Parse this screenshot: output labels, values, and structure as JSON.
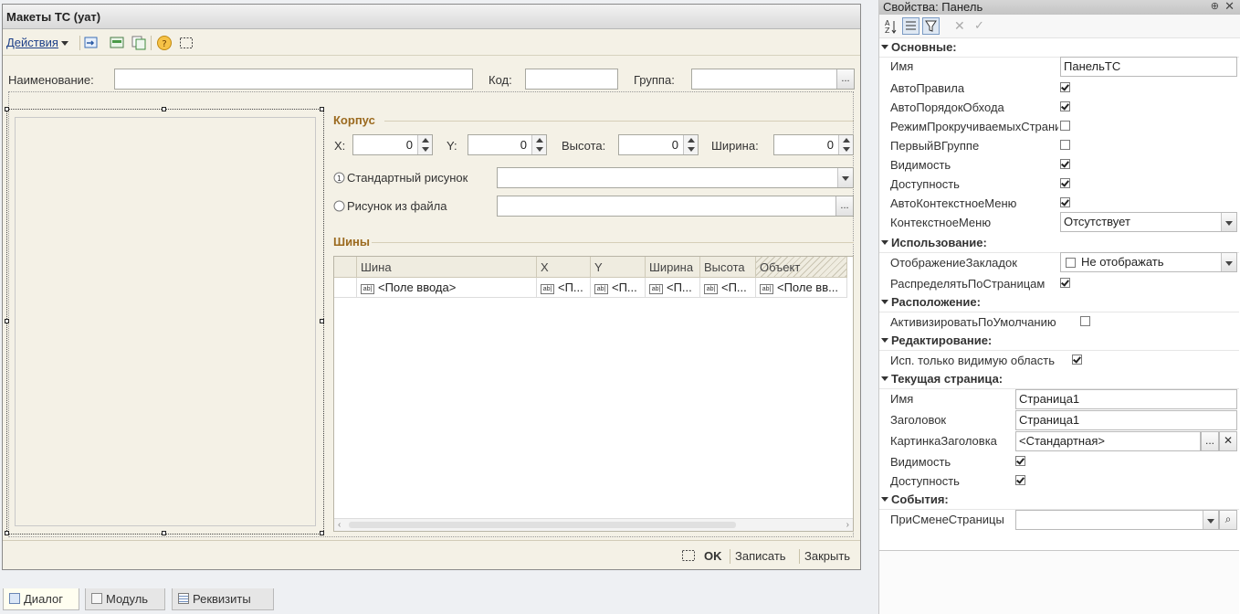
{
  "window": {
    "title": "Макеты ТС (уат)"
  },
  "toolbar": {
    "actions_label": "Действия"
  },
  "header_fields": {
    "name_label": "Наименование:",
    "name_value": "",
    "code_label": "Код:",
    "code_value": "",
    "group_label": "Группа:",
    "group_value": ""
  },
  "body_section": {
    "title": "Корпус",
    "x_label": "X:",
    "x_value": "0",
    "y_label": "Y:",
    "y_value": "0",
    "height_label": "Высота:",
    "height_value": "0",
    "width_label": "Ширина:",
    "width_value": "0",
    "radio_standard": "Стандартный рисунок",
    "radio_file": "Рисунок из файла",
    "standard_value": "",
    "file_value": ""
  },
  "tires_section": {
    "title": "Шины",
    "columns": [
      "Шина",
      "X",
      "Y",
      "Ширина",
      "Высота",
      "Объект"
    ],
    "row": [
      "<Поле ввода>",
      "<П...",
      "<П...",
      "<П...",
      "<П...",
      "<Поле вв..."
    ]
  },
  "statusbar": {
    "ok": "OK",
    "save": "Записать",
    "close": "Закрыть"
  },
  "tabs": [
    "Диалог",
    "Модуль",
    "Реквизиты"
  ],
  "props": {
    "title": "Свойства: Панель",
    "groups": {
      "main": "Основные:",
      "usage": "Использование:",
      "layout": "Расположение:",
      "editing": "Редактирование:",
      "current_page": "Текущая страница:",
      "events": "События:"
    },
    "main": {
      "name_label": "Имя",
      "name_value": "ПанельТС",
      "autorules": "АвтоПравила",
      "autorules_checked": true,
      "autoorder": "АвтоПорядокОбхода",
      "autoorder_checked": true,
      "scrollmode": "РежимПрокручиваемыхСтраниц",
      "scrollmode_checked": false,
      "firstingroup": "ПервыйВГруппе",
      "firstingroup_checked": false,
      "visible": "Видимость",
      "visible_checked": true,
      "enabled": "Доступность",
      "enabled_checked": true,
      "autocontext": "АвтоКонтекстноеМеню",
      "autocontext_checked": true,
      "contextmenu": "КонтекстноеМеню",
      "contextmenu_value": "Отсутствует"
    },
    "usage": {
      "tabs_display": "ОтображениеЗакладок",
      "tabs_display_value": "Не отображать",
      "distribute": "РаспределятьПоСтраницам",
      "distribute_checked": true
    },
    "layout": {
      "activate_default": "АктивизироватьПоУмолчанию",
      "activate_default_checked": false
    },
    "editing": {
      "visible_area": "Исп. только видимую область",
      "visible_area_checked": true
    },
    "current_page": {
      "name_label": "Имя",
      "name_value": "Страница1",
      "caption_label": "Заголовок",
      "caption_value": "Страница1",
      "picture_label": "КартинкаЗаголовка",
      "picture_value": "<Стандартная>",
      "visible": "Видимость",
      "visible_checked": true,
      "enabled": "Доступность",
      "enabled_checked": true
    },
    "events": {
      "onpagechange": "ПриСменеСтраницы",
      "onpagechange_value": ""
    }
  }
}
